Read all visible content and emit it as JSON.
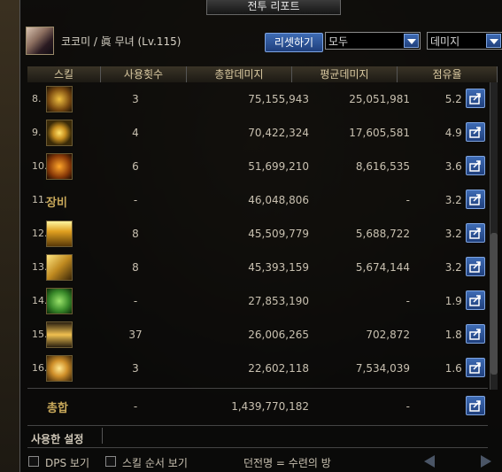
{
  "window": {
    "title": "전투 리포트"
  },
  "character": {
    "name": "코코미 / 眞 무녀 (Lv.115)"
  },
  "controls": {
    "reset_label": "리셋하기",
    "filter_select": "모두",
    "sort_select": "데미지"
  },
  "columns": [
    "스킬",
    "사용횟수",
    "총합데미지",
    "평균데미지",
    "점유율"
  ],
  "rows": [
    {
      "idx": "8.",
      "icon": "dragon-skill-icon",
      "skill_text": "",
      "uses": "3",
      "total": "75,155,943",
      "avg": "25,051,981",
      "share": "5.2 %"
    },
    {
      "idx": "9.",
      "icon": "yin-yang-swirl-icon",
      "skill_text": "",
      "uses": "4",
      "total": "70,422,324",
      "avg": "17,605,581",
      "share": "4.9 %"
    },
    {
      "idx": "10.",
      "icon": "talisman-skill-icon",
      "skill_text": "",
      "uses": "6",
      "total": "51,699,210",
      "avg": "8,616,535",
      "share": "3.6 %"
    },
    {
      "idx": "11.",
      "icon": "",
      "skill_text": "장비",
      "uses": "-",
      "total": "46,048,806",
      "avg": "-",
      "share": "3.2 %"
    },
    {
      "idx": "12.",
      "icon": "lightning-skill-icon",
      "skill_text": "",
      "uses": "8",
      "total": "45,509,779",
      "avg": "5,688,722",
      "share": "3.2 %"
    },
    {
      "idx": "13.",
      "icon": "strike-skill-icon",
      "skill_text": "",
      "uses": "8",
      "total": "45,393,159",
      "avg": "5,674,144",
      "share": "3.2 %"
    },
    {
      "idx": "14.",
      "icon": "green-spirit-skill-icon",
      "skill_text": "",
      "uses": "-",
      "total": "27,853,190",
      "avg": "-",
      "share": "1.9 %"
    },
    {
      "idx": "15.",
      "icon": "dash-skill-icon",
      "skill_text": "",
      "uses": "37",
      "total": "26,006,265",
      "avg": "702,872",
      "share": "1.8 %"
    },
    {
      "idx": "16.",
      "icon": "pinwheel-skill-icon",
      "skill_text": "",
      "uses": "3",
      "total": "22,602,118",
      "avg": "7,534,039",
      "share": "1.6 %"
    }
  ],
  "total": {
    "label": "총합",
    "uses": "-",
    "total": "1,439,770,182",
    "avg": "-"
  },
  "used_settings_label": "사용한 설정",
  "footer": {
    "dps_label": "DPS 보기",
    "skill_order_label": "스킬 순서 보기",
    "dungeon_info": "던전명 = 수련의 방"
  },
  "colors": {
    "accent_blue": "#2f56a0",
    "gold_text": "#c8a85a"
  }
}
